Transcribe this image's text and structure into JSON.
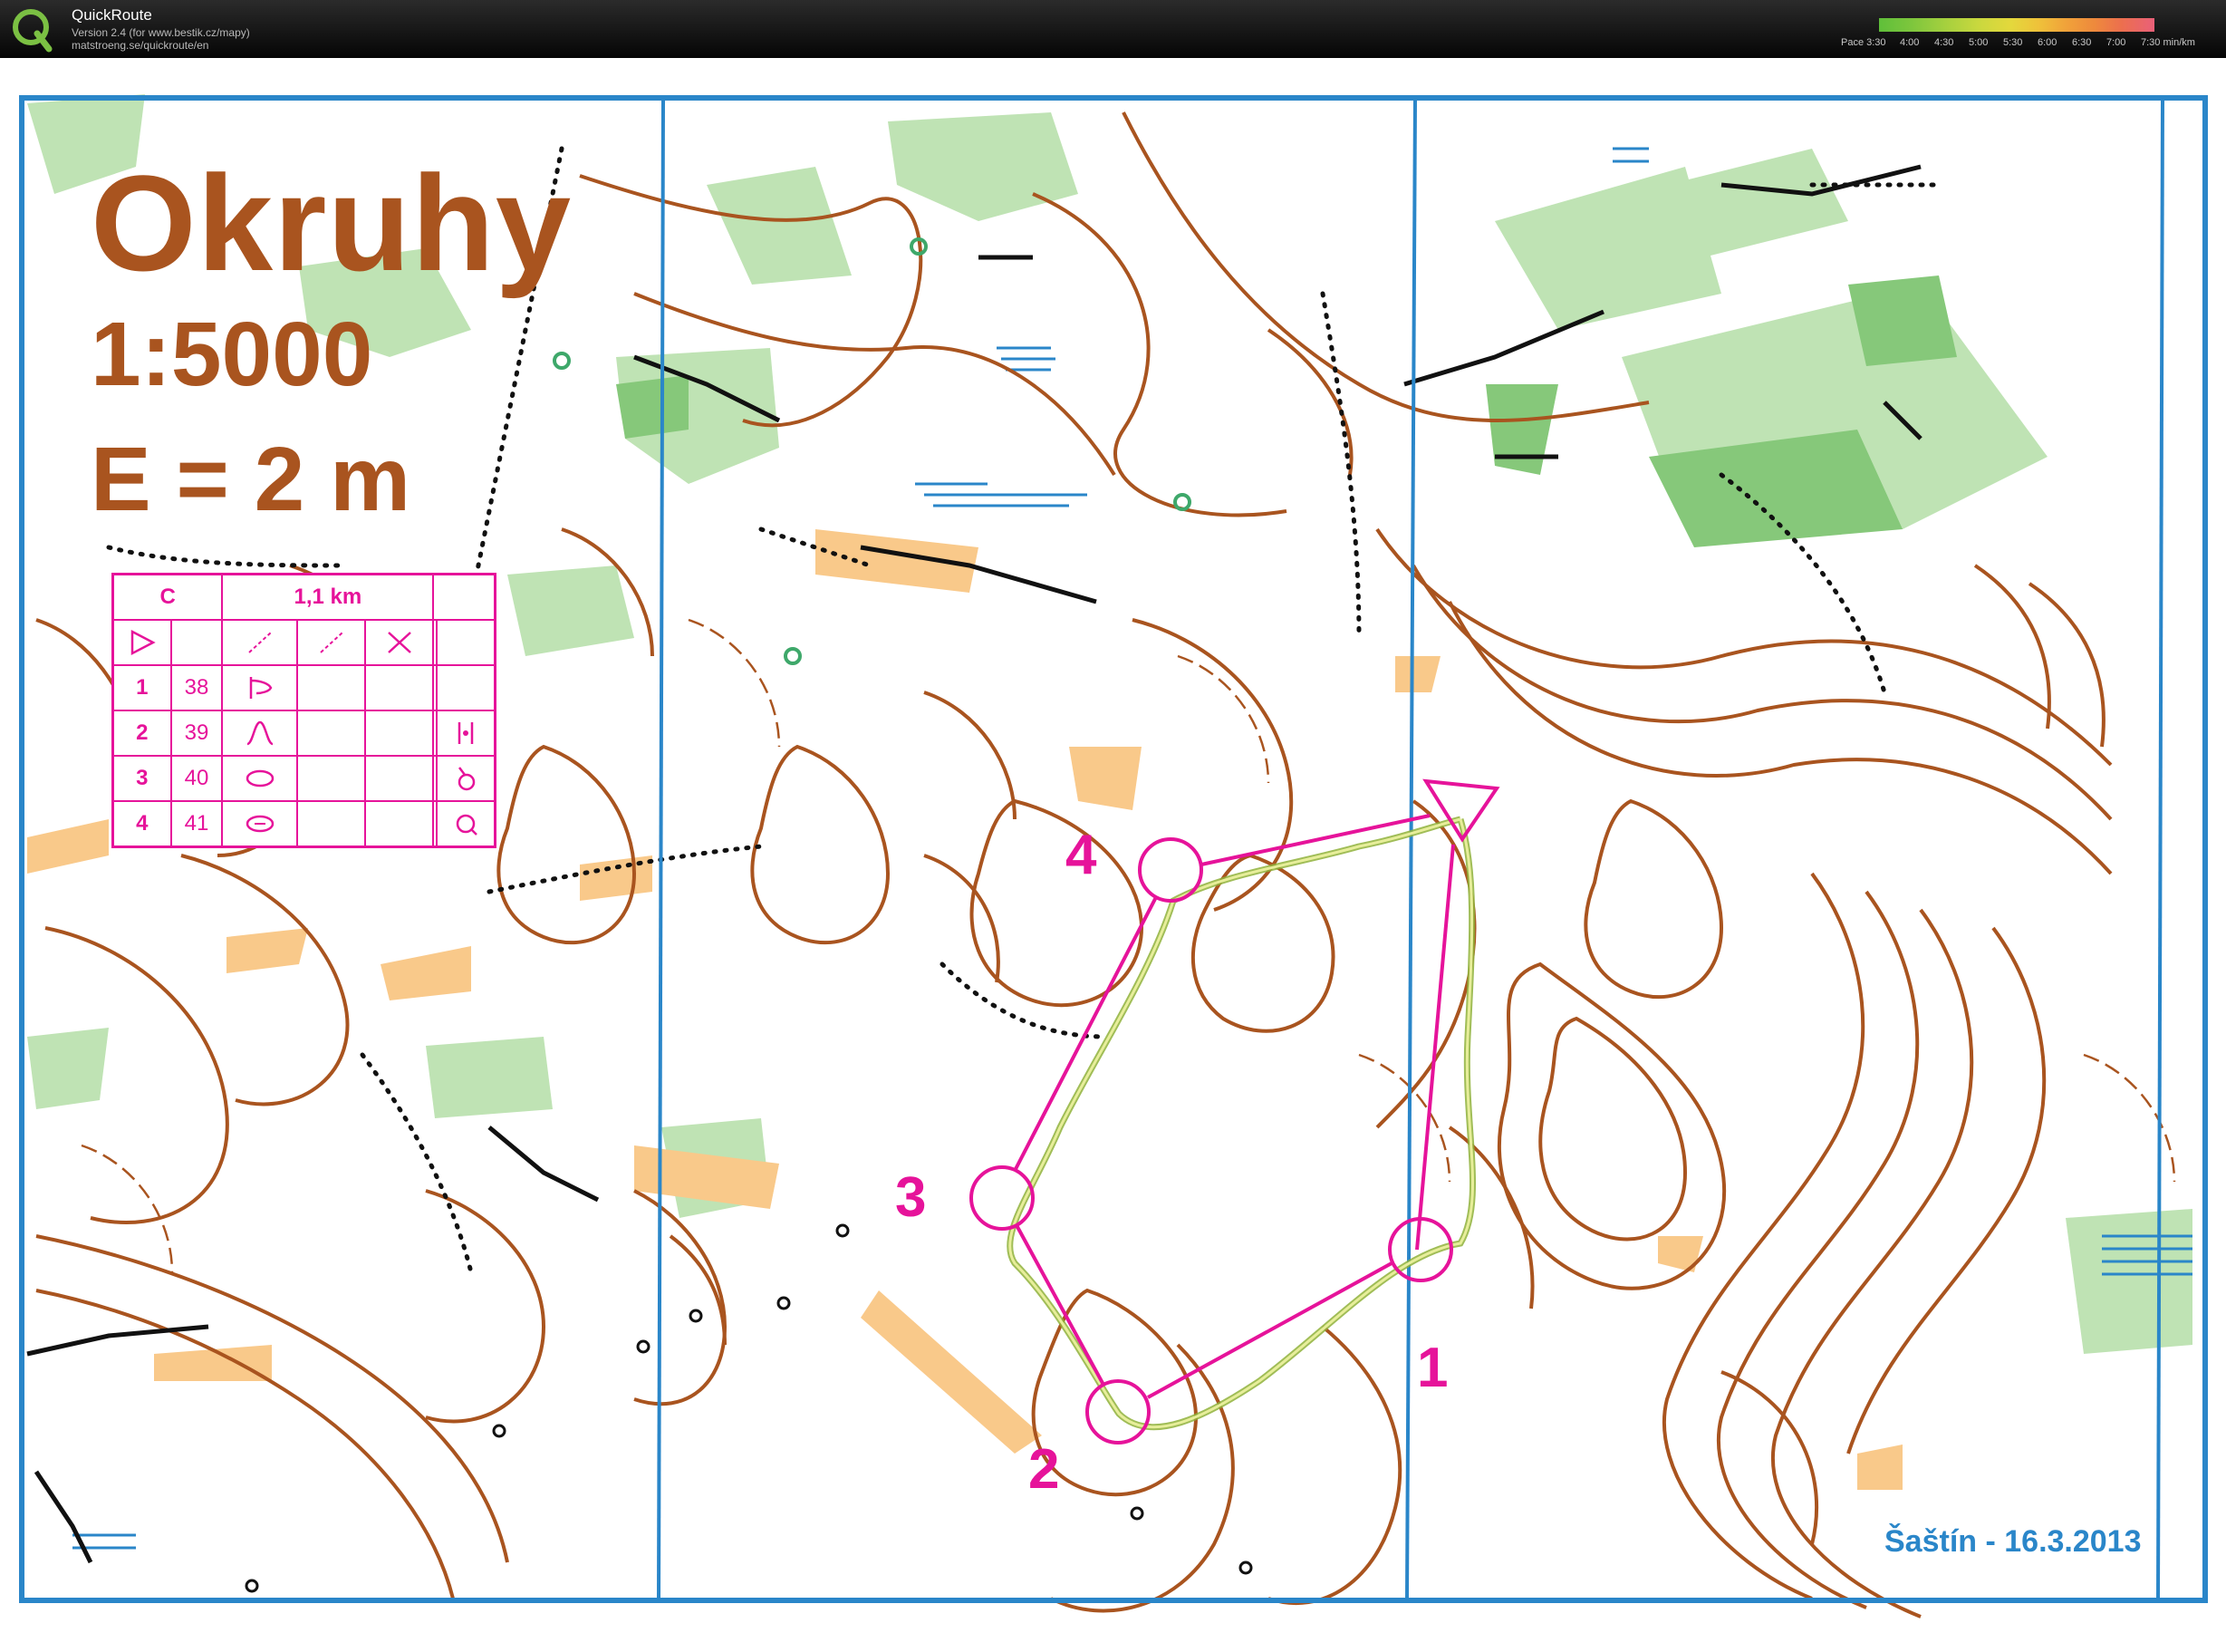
{
  "app": {
    "title": "QuickRoute",
    "version_text": "Version 2.4  (for www.bestik.cz/mapy)",
    "url_text": "matstroeng.se/quickroute/en",
    "logo_icon": "quickroute-q-logo"
  },
  "pace_legend": {
    "label": "Pace 3:30",
    "ticks": [
      "4:00",
      "4:30",
      "5:00",
      "5:30",
      "6:00",
      "6:30",
      "7:00",
      "7:30 min/km"
    ]
  },
  "map": {
    "title": "Okruhy",
    "scale": "1:5000",
    "equidistance": "E = 2 m",
    "footer": "Šaštín - 16.3.2013",
    "colors": {
      "contour": "#a9541f",
      "course": "#e6139a",
      "north_lines": "#2a86c9",
      "vegetation": "#bfe3b4",
      "open_land": "#f9c98a",
      "route": "#9bbd48"
    },
    "controls": [
      {
        "number": "1"
      },
      {
        "number": "2"
      },
      {
        "number": "3"
      },
      {
        "number": "4"
      }
    ]
  },
  "description_sheet": {
    "class": "C",
    "length": "1,1 km",
    "start_icon": "start-triangle-icon",
    "header_symbols": [
      "slope-icon",
      "slope-icon",
      "crossing-icon"
    ],
    "rows": [
      {
        "number": "1",
        "code": "38",
        "feature_icon": "spur-icon",
        "detail_icon": ""
      },
      {
        "number": "2",
        "code": "39",
        "feature_icon": "knoll-icon",
        "detail_icon": "between-icon"
      },
      {
        "number": "3",
        "code": "40",
        "feature_icon": "depression-icon",
        "detail_icon": "foot-icon"
      },
      {
        "number": "4",
        "code": "41",
        "feature_icon": "pit-icon",
        "detail_icon": "part-icon"
      }
    ]
  }
}
